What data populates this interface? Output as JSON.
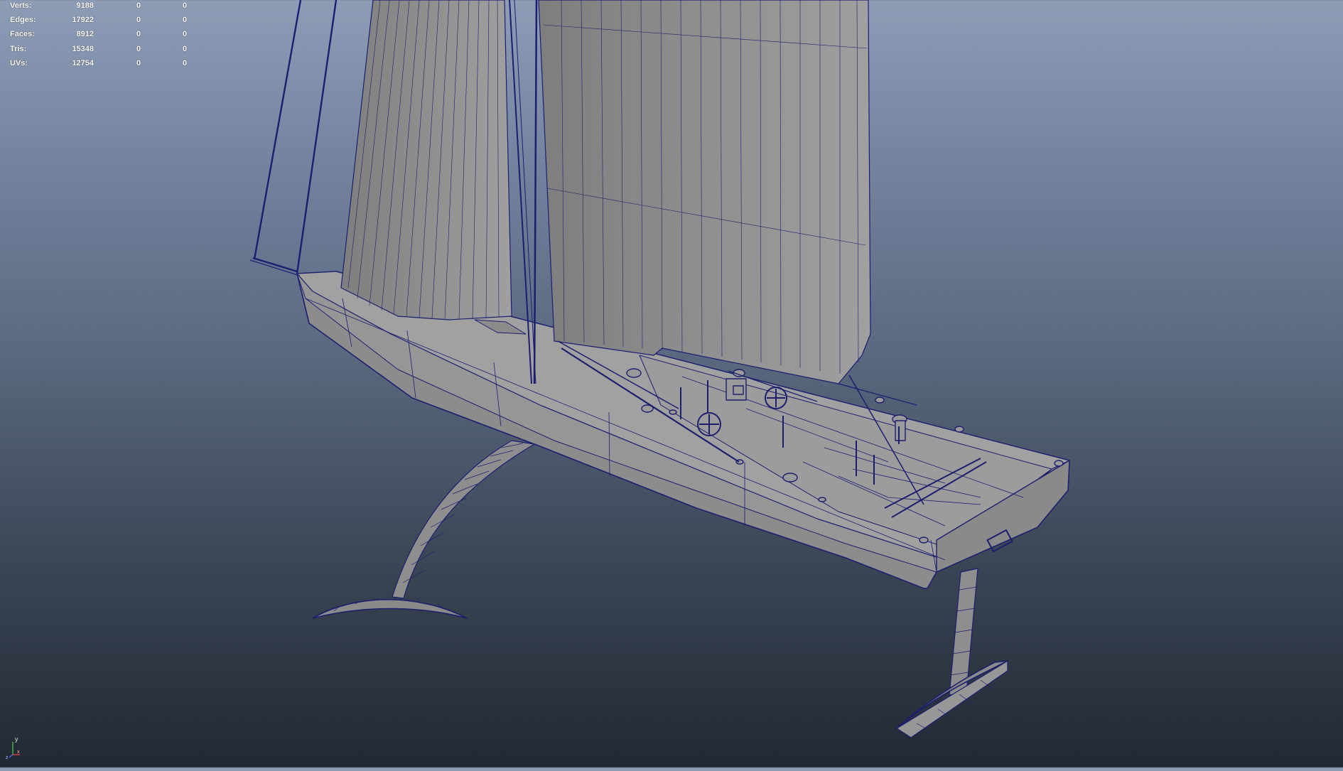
{
  "hud": {
    "rows": [
      {
        "label": "Verts:",
        "values": [
          "9188",
          "0",
          "0"
        ]
      },
      {
        "label": "Edges:",
        "values": [
          "17922",
          "0",
          "0"
        ]
      },
      {
        "label": "Faces:",
        "values": [
          "8912",
          "0",
          "0"
        ]
      },
      {
        "label": "Tris:",
        "values": [
          "15348",
          "0",
          "0"
        ]
      },
      {
        "label": "UVs:",
        "values": [
          "12754",
          "0",
          "0"
        ]
      }
    ]
  },
  "axis": {
    "y_label": "y",
    "x_label": "x",
    "z_label": "z"
  },
  "colors": {
    "background_top": "#8d9db6",
    "background_bottom": "#222833",
    "mesh_fill": "#929292",
    "wireframe": "#1c1f6e"
  },
  "scene": {
    "object": "sailboat-mesh",
    "shading": "wireframe-on-shaded"
  }
}
